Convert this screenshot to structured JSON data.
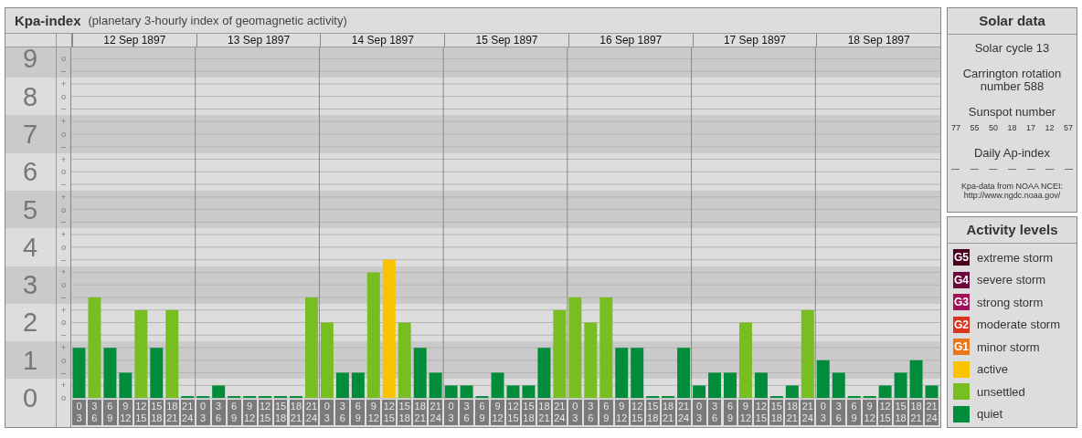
{
  "chart_panel": {
    "title": "Kpa-index",
    "subtitle": "(planetary 3-hourly index of geomagnetic activity)",
    "days": [
      "12 Sep 1897",
      "13 Sep 1897",
      "14 Sep 1897",
      "15 Sep 1897",
      "16 Sep 1897",
      "17 Sep 1897",
      "18 Sep 1897"
    ],
    "sublevel_ticks": [
      "o",
      "–",
      "+",
      "o",
      "–",
      "+",
      "o",
      "–",
      "+",
      "o",
      "–",
      "+",
      "o",
      "–",
      "+",
      "o",
      "–",
      "+",
      "o",
      "–",
      "+",
      "o",
      "–",
      "+",
      "o",
      "–",
      "+",
      "o"
    ],
    "chart_data": {
      "type": "bar",
      "ylim": [
        0,
        9.3
      ],
      "yticks": [
        0,
        1,
        2,
        3,
        4,
        5,
        6,
        7,
        8,
        9
      ],
      "grid": true,
      "categories": [
        "0 3",
        "3 6",
        "6 9",
        "9 12",
        "12 15",
        "15 18",
        "18 21",
        "21 24",
        "0 3",
        "3 6",
        "6 9",
        "9 12",
        "12 15",
        "15 18",
        "18 21",
        "21 24",
        "0 3",
        "3 6",
        "6 9",
        "9 12",
        "12 15",
        "15 18",
        "18 21",
        "21 24",
        "0 3",
        "3 6",
        "6 9",
        "9 12",
        "12 15",
        "15 18",
        "18 21",
        "21 24",
        "0 3",
        "3 6",
        "6 9",
        "9 12",
        "12 15",
        "15 18",
        "18 21",
        "21 24",
        "0 3",
        "3 6",
        "6 9",
        "9 12",
        "12 15",
        "15 18",
        "18 21",
        "21 24",
        "0 3",
        "3 6",
        "6 9",
        "9 12",
        "12 15",
        "15 18",
        "18 21",
        "21 24"
      ],
      "series": [
        {
          "name": "quiet",
          "color": "#008c3a",
          "values": [
            1.33,
            null,
            1.33,
            0.67,
            null,
            1.33,
            null,
            0,
            0,
            0.33,
            0,
            0,
            0,
            0,
            0,
            null,
            null,
            0.67,
            0.67,
            null,
            null,
            null,
            1.33,
            0.67,
            0.33,
            0.33,
            0,
            0.67,
            0.33,
            0.33,
            1.33,
            null,
            null,
            null,
            null,
            1.33,
            1.33,
            0,
            0,
            1.33,
            0.33,
            0.67,
            0.67,
            null,
            0.67,
            0,
            0.33,
            null,
            1,
            0.67,
            0,
            0,
            0.33,
            0.67,
            1,
            0.33
          ]
        },
        {
          "name": "unsettled",
          "color": "#78be20",
          "values": [
            null,
            2.67,
            null,
            null,
            2.33,
            null,
            2.33,
            null,
            null,
            null,
            null,
            null,
            null,
            null,
            null,
            2.67,
            2,
            null,
            null,
            3.33,
            null,
            2,
            null,
            null,
            null,
            null,
            null,
            null,
            null,
            null,
            null,
            2.33,
            2.67,
            2,
            2.67,
            null,
            null,
            null,
            null,
            null,
            null,
            null,
            null,
            2,
            null,
            null,
            null,
            2.33,
            null,
            null,
            null,
            null,
            null,
            null,
            null,
            null
          ]
        },
        {
          "name": "active",
          "color": "#f9c300",
          "values": [
            null,
            null,
            null,
            null,
            null,
            null,
            null,
            null,
            null,
            null,
            null,
            null,
            null,
            null,
            null,
            null,
            null,
            null,
            null,
            null,
            3.67,
            null,
            null,
            null,
            null,
            null,
            null,
            null,
            null,
            null,
            null,
            null,
            null,
            null,
            null,
            null,
            null,
            null,
            null,
            null,
            null,
            null,
            null,
            null,
            null,
            null,
            null,
            null,
            null,
            null,
            null,
            null,
            null,
            null,
            null,
            null
          ]
        }
      ]
    }
  },
  "solar": {
    "title": "Solar data",
    "cycle": "Solar cycle 13",
    "rotation": "Carrington rotation number 588",
    "sunspot_heading": "Sunspot number",
    "sunspot_numbers": [
      "77",
      "55",
      "50",
      "18",
      "17",
      "12",
      "57"
    ],
    "ap_heading": "Daily Ap-index",
    "ap_values": [
      "—",
      "—",
      "—",
      "—",
      "—",
      "—",
      "—"
    ],
    "source": "Kpa-data from NOAA NCEI:",
    "source_url": "http://www.ngdc.noaa.gov/"
  },
  "activity_levels": {
    "title": "Activity levels",
    "items": [
      {
        "badge": "G5",
        "label": "extreme storm",
        "color": "#4a0020"
      },
      {
        "badge": "G4",
        "label": "severe storm",
        "color": "#6a0a3a"
      },
      {
        "badge": "G3",
        "label": "strong storm",
        "color": "#a3105a"
      },
      {
        "badge": "G2",
        "label": "moderate storm",
        "color": "#d8341e"
      },
      {
        "badge": "G1",
        "label": "minor storm",
        "color": "#e8781a"
      }
    ]
  }
}
